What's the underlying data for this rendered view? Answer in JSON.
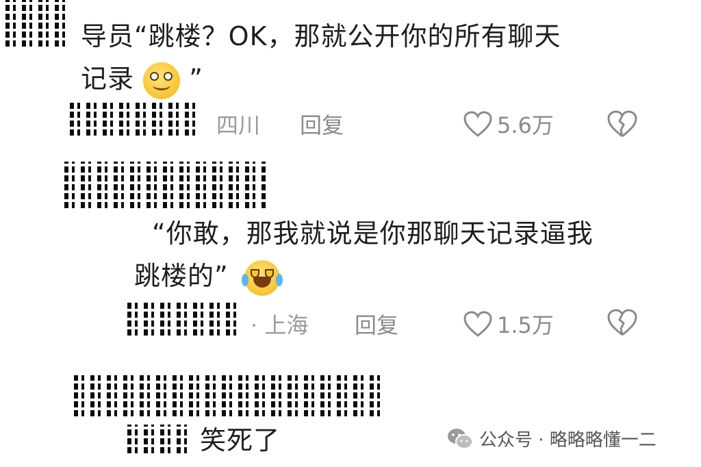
{
  "comments": [
    {
      "text_line1": "导员“跳楼？OK，那就公开你的所有聊天",
      "text_line2": "记录",
      "close_quote": "”",
      "location": "四川",
      "reply_label": "回复",
      "likes": "5.6万"
    },
    {
      "text_line1": "“你敢，那我就说是你那聊天记录逼我",
      "text_line2": "跳楼的”",
      "location": "· 上海",
      "reply_label": "回复",
      "likes": "1.5万"
    },
    {
      "text": "笑死了"
    }
  ],
  "footer": {
    "source": "公众号 · 略略略懂一二"
  },
  "icons": [
    "heart-outline-icon",
    "broken-heart-icon",
    "wechat-icon",
    "smile-emoji-icon",
    "crying-laugh-emoji-icon"
  ],
  "colors": {
    "text": "#1e1e1e",
    "meta": "#9a9a9a",
    "background": "#ffffff"
  }
}
